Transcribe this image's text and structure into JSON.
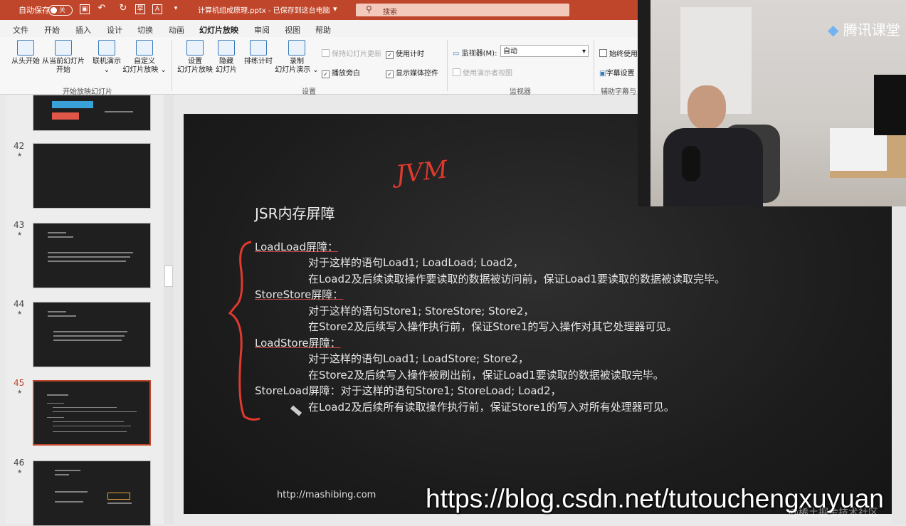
{
  "titlebar": {
    "autosave_label": "自动保存",
    "autosave_state": "关",
    "doc_title": "计算机组成原理.pptx - 已保存到这台电脑",
    "search_placeholder": "搜索"
  },
  "menu_tabs": [
    "文件",
    "开始",
    "插入",
    "设计",
    "切换",
    "动画",
    "幻灯片放映",
    "审阅",
    "视图",
    "帮助"
  ],
  "ribbon": {
    "from_start": "从头开始",
    "from_current_1": "从当前幻灯片",
    "from_current_2": "开始",
    "online_present": "联机演示",
    "custom_1": "自定义",
    "custom_2": "幻灯片放映",
    "group_start": "开始放映幻灯片",
    "setup_1": "设置",
    "setup_2": "幻灯片放映",
    "hide_1": "隐藏",
    "hide_2": "幻灯片",
    "rehearse": "排练计时",
    "record_1": "录制",
    "record_2": "幻灯片演示",
    "keep_updated": "保持幻灯片更新",
    "use_timings": "使用计时",
    "play_narration": "播放旁白",
    "show_media": "显示媒体控件",
    "group_setup": "设置",
    "monitor_label": "监视器(M):",
    "monitor_value": "自动",
    "presenter_view": "使用演示者视图",
    "group_monitor": "监视器",
    "always_use": "始终使用",
    "subtitle_settings": "字幕设置",
    "group_captions": "辅助字幕与"
  },
  "thumbnails": [
    {
      "num": "42"
    },
    {
      "num": "43"
    },
    {
      "num": "44"
    },
    {
      "num": "45"
    },
    {
      "num": "46"
    }
  ],
  "slide": {
    "annotation": "JVM",
    "title": "JSR内存屏障",
    "lines": [
      "LoadLoad屏障：",
      "对于这样的语句Load1; LoadLoad; Load2，",
      "在Load2及后续读取操作要读取的数据被访问前，保证Load1要读取的数据被读取完毕。",
      "StoreStore屏障：",
      "对于这样的语句Store1; StoreStore; Store2，",
      "在Store2及后续写入操作执行前，保证Store1的写入操作对其它处理器可见。",
      "LoadStore屏障：",
      "对于这样的语句Load1; LoadStore; Store2，",
      "在Store2及后续写入操作被刷出前，保证Load1要读取的数据被读取完毕。",
      "StoreLoad屏障：对于这样的语句Store1; StoreLoad; Load2，",
      "在Load2及后续所有读取操作执行前，保证Store1的写入对所有处理器可见。"
    ],
    "url": "http://mashibing.com"
  },
  "webcam": {
    "logo": "腾讯课堂"
  },
  "watermark": {
    "url": "https://blog.csdn.net/tutouchengxuyuan",
    "faint": "@稀土掘金技术社区"
  }
}
